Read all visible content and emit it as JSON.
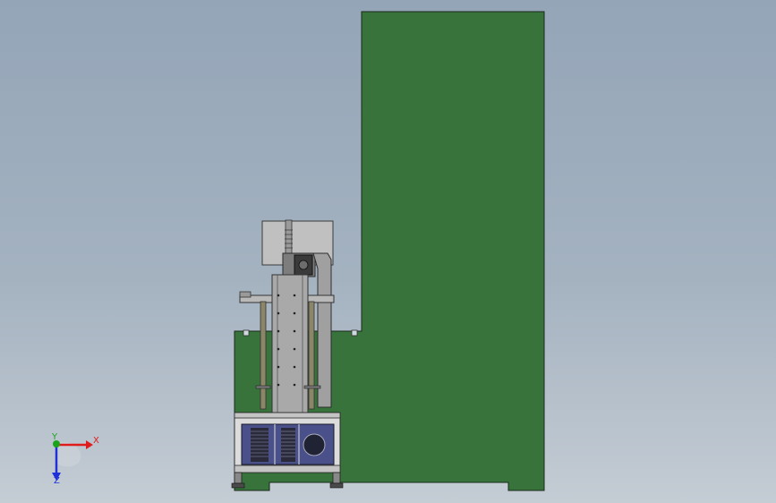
{
  "viewport": {
    "background_top": "#94a5b8",
    "background_bottom": "#c4ccd4"
  },
  "model": {
    "frame_color": "#37733b",
    "outline_color": "#1b2a1b",
    "housing_color": "#c0c0c0",
    "cabinet_color": "#dcdcdc",
    "panel_color": "#49508a",
    "column_color": "#a9a9a9",
    "guide_rod_color": "#8c8668"
  },
  "triad": {
    "x_label": "X",
    "y_label": "Y",
    "z_label": "Z",
    "x_color": "#e01b1b",
    "y_color": "#1ba31b",
    "z_color": "#2030d8"
  }
}
